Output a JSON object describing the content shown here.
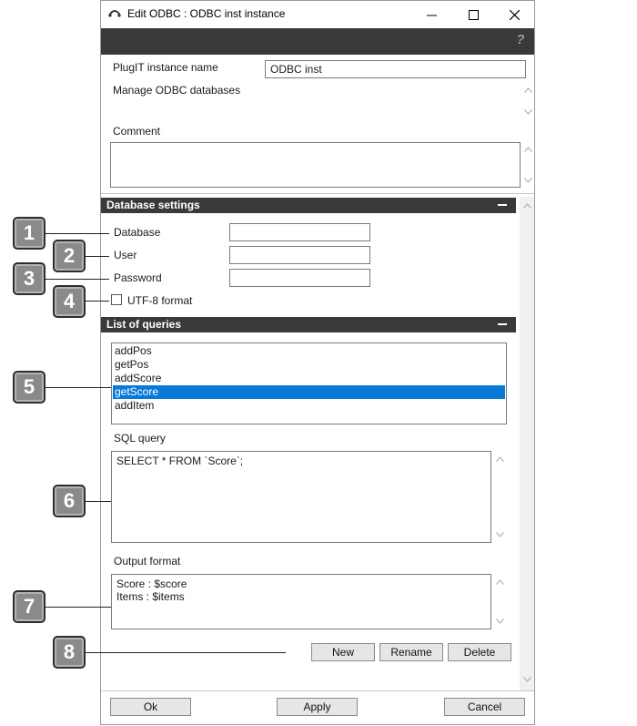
{
  "window": {
    "title": "Edit ODBC : ODBC inst instance"
  },
  "header_form": {
    "instance_name_label": "PlugIT instance name",
    "instance_name_value": "ODBC inst",
    "description": "Manage ODBC databases",
    "comment_label": "Comment",
    "comment_value": ""
  },
  "database_settings": {
    "title": "Database settings",
    "database_label": "Database",
    "database_value": "",
    "user_label": "User",
    "user_value": "",
    "password_label": "Password",
    "password_value": "",
    "utf8_label": "UTF-8 format",
    "utf8_checked": false
  },
  "queries": {
    "title": "List of queries",
    "items": [
      "addPos",
      "getPos",
      "addScore",
      "getScore",
      "addItem"
    ],
    "selected": "getScore",
    "sql_label": "SQL query",
    "sql_value": "SELECT * FROM `Score`;",
    "output_label": "Output format",
    "output_lines": [
      "Score : $score",
      "Items : $items"
    ],
    "new_label": "New",
    "rename_label": "Rename",
    "delete_label": "Delete"
  },
  "footer": {
    "ok_label": "Ok",
    "apply_label": "Apply",
    "cancel_label": "Cancel"
  },
  "callouts": [
    "1",
    "2",
    "3",
    "4",
    "5",
    "6",
    "7",
    "8"
  ],
  "colors": {
    "dark_bar": "#3a3a3a",
    "selection": "#0a78d7",
    "callout": "#8a8a8a"
  }
}
